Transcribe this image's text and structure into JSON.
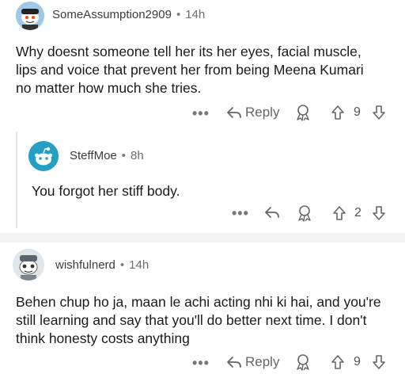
{
  "comments": [
    {
      "username": "SomeAssumption2909",
      "time": "14h",
      "body": "Why doesnt someone tell her its her eyes, facial muscle, lips and voice that prevent her from being Meena Kumari  no matter how much she tries.",
      "reply_label": "Reply",
      "vote_count": "9"
    },
    {
      "username": "SteffMoe",
      "time": "8h",
      "body": "You forgot her stiff body.",
      "vote_count": "2"
    },
    {
      "username": "wishfulnerd",
      "time": "14h",
      "body": "Behen chup ho ja, maan le achi acting nhi ki hai, and you're still learning and say that you'll do better next time. I don't think honesty costs anything",
      "reply_label": "Reply",
      "vote_count": "9"
    }
  ],
  "separator": "•",
  "more_label": "•••",
  "colors": {
    "avatar_teal": "#24a0c4",
    "text": "#1a1a1b",
    "muted": "#666666"
  }
}
